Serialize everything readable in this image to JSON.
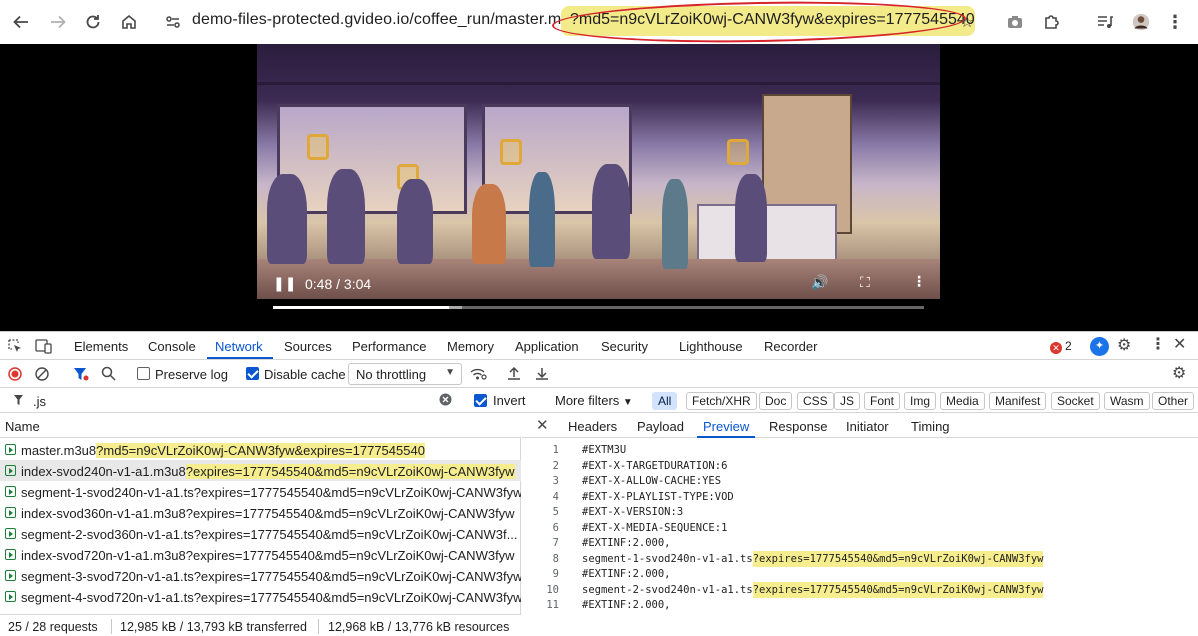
{
  "browser": {
    "url_host": "demo-files-protected.gvideo.io/coffee_run/master.m3u8",
    "url_query": "?md5=n9cVLrZoiK0wj-CANW3fyw&expires=1777545540",
    "url_host_visible": "demo-files-protected.gvideo.io/coffee_run/master.m3u",
    "url_query_visible": "md5=n9cVLrZoiK0wj-CANW3fyw&expires=1777545540"
  },
  "video": {
    "time": "0:48 / 3:04",
    "progress": 0.27,
    "buffered": 0.29
  },
  "devtools": {
    "tabs": [
      "Elements",
      "Console",
      "Network",
      "Sources",
      "Performance",
      "Memory",
      "Application",
      "Security",
      "Lighthouse",
      "Recorder"
    ],
    "active_tab": "Network",
    "error_count": "2",
    "toolbar": {
      "preserve_log": "Preserve log",
      "disable_cache": "Disable cache",
      "throttling": "No throttling"
    },
    "filter": {
      "text": ".js",
      "invert": "Invert",
      "more_filters": "More filters",
      "chips": [
        "All",
        "Fetch/XHR",
        "Doc",
        "CSS",
        "JS",
        "Font",
        "Img",
        "Media",
        "Manifest",
        "Socket",
        "Wasm",
        "Other"
      ]
    },
    "name_header": "Name",
    "requests": [
      {
        "base": "master.m3u8",
        "query": "?md5=n9cVLrZoiK0wj-CANW3fyw&expires=1777545540",
        "highlight": true
      },
      {
        "base": "index-svod240n-v1-a1.m3u8",
        "query": "?expires=1777545540&md5=n9cVLrZoiK0wj-CANW3fyw",
        "highlight": true
      },
      {
        "base": "segment-1-svod240n-v1-a1.ts",
        "query": "?expires=1777545540&md5=n9cVLrZoiK0wj-CANW3fyw",
        "highlight": false
      },
      {
        "base": "index-svod360n-v1-a1.m3u8",
        "query": "?expires=1777545540&md5=n9cVLrZoiK0wj-CANW3fyw",
        "highlight": false
      },
      {
        "base": "segment-2-svod360n-v1-a1.ts",
        "query": "?expires=1777545540&md5=n9cVLrZoiK0wj-CANW3f...",
        "highlight": false
      },
      {
        "base": "index-svod720n-v1-a1.m3u8",
        "query": "?expires=1777545540&md5=n9cVLrZoiK0wj-CANW3fyw",
        "highlight": false
      },
      {
        "base": "segment-3-svod720n-v1-a1.ts",
        "query": "?expires=1777545540&md5=n9cVLrZoiK0wj-CANW3fyw",
        "highlight": false
      },
      {
        "base": "segment-4-svod720n-v1-a1.ts",
        "query": "?expires=1777545540&md5=n9cVLrZoiK0wj-CANW3fyw",
        "highlight": false
      }
    ],
    "status": {
      "requests": "25 / 28 requests",
      "transferred": "12,985 kB / 13,793 kB transferred",
      "resources": "12,968 kB / 13,776 kB resources"
    },
    "preview_tabs": [
      "Headers",
      "Payload",
      "Preview",
      "Response",
      "Initiator",
      "Timing"
    ],
    "preview_active": "Preview",
    "preview_lines": [
      {
        "n": "1",
        "text": "#EXTM3U",
        "hl": ""
      },
      {
        "n": "2",
        "text": "#EXT-X-TARGETDURATION:6",
        "hl": ""
      },
      {
        "n": "3",
        "text": "#EXT-X-ALLOW-CACHE:YES",
        "hl": ""
      },
      {
        "n": "4",
        "text": "#EXT-X-PLAYLIST-TYPE:VOD",
        "hl": ""
      },
      {
        "n": "5",
        "text": "#EXT-X-VERSION:3",
        "hl": ""
      },
      {
        "n": "6",
        "text": "#EXT-X-MEDIA-SEQUENCE:1",
        "hl": ""
      },
      {
        "n": "7",
        "text": "#EXTINF:2.000,",
        "hl": ""
      },
      {
        "n": "8",
        "text": "segment-1-svod240n-v1-a1.ts",
        "hl": "?expires=1777545540&md5=n9cVLrZoiK0wj-CANW3fyw"
      },
      {
        "n": "9",
        "text": "#EXTINF:2.000,",
        "hl": ""
      },
      {
        "n": "10",
        "text": "segment-2-svod240n-v1-a1.ts",
        "hl": "?expires=1777545540&md5=n9cVLrZoiK0wj-CANW3fyw"
      },
      {
        "n": "11",
        "text": "#EXTINF:2.000,",
        "hl": ""
      }
    ]
  }
}
